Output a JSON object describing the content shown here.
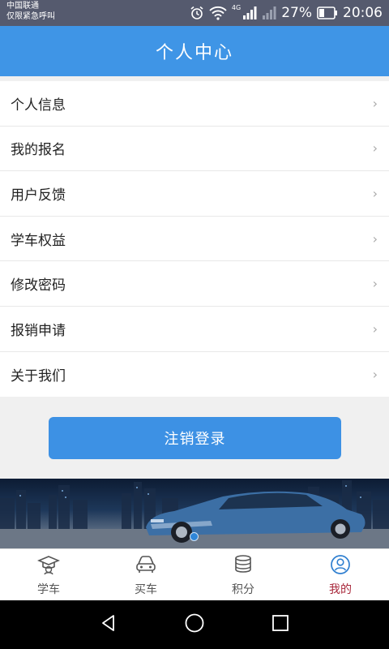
{
  "status_bar": {
    "carrier_line1": "中国联通",
    "carrier_line2": "仅限紧急呼叫",
    "network": "4G",
    "battery": "27%",
    "time": "20:06"
  },
  "header": {
    "title": "个人中心"
  },
  "menu": {
    "items": [
      {
        "label": "个人信息"
      },
      {
        "label": "我的报名"
      },
      {
        "label": "用户反馈"
      },
      {
        "label": "学车权益"
      },
      {
        "label": "修改密码"
      },
      {
        "label": "报销申请"
      },
      {
        "label": "关于我们"
      }
    ],
    "chevron": "›"
  },
  "logout": {
    "label": "注销登录"
  },
  "tabs": [
    {
      "label": "学车",
      "icon": "graduation-icon"
    },
    {
      "label": "买车",
      "icon": "car-icon"
    },
    {
      "label": "积分",
      "icon": "coins-icon"
    },
    {
      "label": "我的",
      "icon": "user-icon",
      "active": true
    }
  ],
  "colors": {
    "primary": "#3f95e6",
    "active_tab": "#a8273a"
  }
}
